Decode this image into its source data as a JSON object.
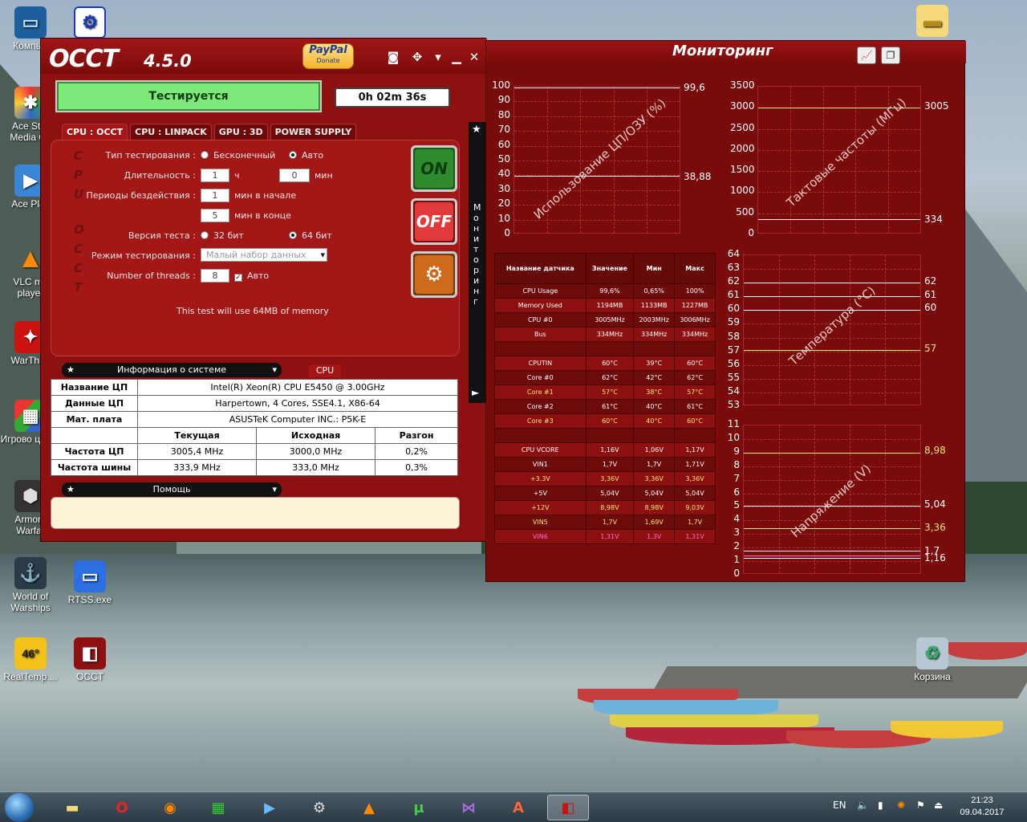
{
  "desktop": {
    "icons": [
      {
        "label": "Компью"
      },
      {
        "label": ""
      },
      {
        "label": "Ace Stre Media Ce"
      },
      {
        "label": "Ace Play"
      },
      {
        "label": "VLC me player"
      },
      {
        "label": "WarThun"
      },
      {
        "label": "Игрово центр"
      },
      {
        "label": "Armore Warfar"
      },
      {
        "label": "World of Warships"
      },
      {
        "label": "RTSS.exe"
      },
      {
        "label": "RealTemp...."
      },
      {
        "label": "OCCT"
      },
      {
        "label": "Корзина"
      }
    ]
  },
  "occt": {
    "logo": "OCCT",
    "version": "4.5.0",
    "paypal": {
      "brand": "PayPal",
      "action": "Donate"
    },
    "status": "Тестируется",
    "timer": "0h 02m 36s",
    "tabs": [
      "CPU : OCCT",
      "CPU : LINPACK",
      "GPU : 3D",
      "POWER SUPPLY"
    ],
    "side_letters_top": [
      "C",
      "P",
      "U"
    ],
    "side_letters_bottom": [
      "O",
      "C",
      "C",
      "T"
    ],
    "form": {
      "test_type_label": "Тип тестирования :",
      "test_type_opt1": "Бесконечный",
      "test_type_opt2": "Авто",
      "duration_label": "Длительность :",
      "duration_hours": "1",
      "hours_unit": "ч",
      "duration_minutes": "0",
      "minutes_unit": "мин",
      "idle_label": "Периоды бездействия :",
      "idle_start": "1",
      "idle_start_unit": "мин в начале",
      "idle_end": "5",
      "idle_end_unit": "мин в конце",
      "version_label": "Версия теста :",
      "version_opt1": "32 бит",
      "version_opt2": "64 бит",
      "mode_label": "Режим тестирования :",
      "mode_value": "Малый набор данных",
      "threads_label": "Number of threads :",
      "threads_value": "8",
      "threads_auto": "Авто",
      "memory_note": "This test will use 64MB of memory"
    },
    "buttons": {
      "on": "ON",
      "off": "OFF"
    },
    "monitor_vertical": "Мониторинг",
    "sysinfo": {
      "header": "Информация о системе",
      "cpu_tab": "CPU",
      "rows": [
        {
          "k": "Название ЦП",
          "v": "Intel(R) Xeon(R) CPU E5450 @ 3.00GHz"
        },
        {
          "k": "Данные ЦП",
          "v": "Harpertown, 4 Cores, SSE4.1, X86-64"
        },
        {
          "k": "Мат. плата",
          "v": "ASUSTeK Computer INC.: P5K-E"
        }
      ],
      "freq_headers": [
        "Текущая",
        "Исходная",
        "Разгон"
      ],
      "freq_rows": [
        {
          "k": "Частота ЦП",
          "cur": "3005,4 MHz",
          "base": "3000,0 MHz",
          "oc": "0,2%"
        },
        {
          "k": "Частота шины",
          "cur": "333,9 MHz",
          "base": "333,0 MHz",
          "oc": "0,3%"
        }
      ]
    },
    "help": {
      "header": "Помощь"
    }
  },
  "monitor": {
    "title": "Мониторинг",
    "charts": {
      "cpu_mem": {
        "title": "Использование ЦП/ОЗУ (%)",
        "ticks": [
          "100",
          "90",
          "80",
          "70",
          "60",
          "50",
          "40",
          "30",
          "20",
          "10",
          "0"
        ],
        "end_labels": [
          "99,6",
          "38,88"
        ]
      },
      "freq": {
        "title": "Тактовые частоты (МГц)",
        "ticks": [
          "3500",
          "3000",
          "2500",
          "2000",
          "1500",
          "1000",
          "500",
          "0"
        ],
        "end_labels": [
          "3005",
          "334"
        ]
      },
      "temp": {
        "title": "Температура (°С)",
        "ticks": [
          "64",
          "63",
          "62",
          "61",
          "60",
          "59",
          "58",
          "57",
          "56",
          "55",
          "54",
          "53"
        ],
        "end_labels": [
          "62",
          "61",
          "60",
          "57"
        ]
      },
      "volt": {
        "title": "Напряжение (V)",
        "ticks": [
          "11",
          "10",
          "9",
          "8",
          "7",
          "6",
          "5",
          "4",
          "3",
          "2",
          "1",
          "0"
        ],
        "end_labels": [
          "8,98",
          "5,04",
          "3,36",
          "1,7",
          "1,16"
        ]
      }
    },
    "sensors": {
      "headers": [
        "Название датчика",
        "Значение",
        "Мин",
        "Макс"
      ],
      "rows": [
        {
          "n": "CPU Usage",
          "v": "99,6%",
          "min": "0,65%",
          "max": "100%",
          "c": "#ffffff"
        },
        {
          "n": "Memory Used",
          "v": "1194MB",
          "min": "1133MB",
          "max": "1227MB",
          "c": "#ffffff"
        },
        {
          "n": "CPU #0",
          "v": "3005MHz",
          "min": "2003MHz",
          "max": "3006MHz",
          "c": "#ffffff"
        },
        {
          "n": "Bus",
          "v": "334MHz",
          "min": "334MHz",
          "max": "334MHz",
          "c": "#ffffff"
        },
        {
          "n": "",
          "v": "",
          "min": "",
          "max": "",
          "c": "#ffffff"
        },
        {
          "n": "CPUTIN",
          "v": "60°C",
          "min": "39°C",
          "max": "60°C",
          "c": "#ffffff"
        },
        {
          "n": "Core #0",
          "v": "62°C",
          "min": "42°C",
          "max": "62°C",
          "c": "#ffffff"
        },
        {
          "n": "Core #1",
          "v": "57°C",
          "min": "38°C",
          "max": "57°C",
          "c": "#f4e86a"
        },
        {
          "n": "Core #2",
          "v": "61°C",
          "min": "40°C",
          "max": "61°C",
          "c": "#ffffff"
        },
        {
          "n": "Core #3",
          "v": "60°C",
          "min": "40°C",
          "max": "60°C",
          "c": "#f4e86a"
        },
        {
          "n": "",
          "v": "",
          "min": "",
          "max": "",
          "c": "#ffffff"
        },
        {
          "n": "CPU VCORE",
          "v": "1,16V",
          "min": "1,06V",
          "max": "1,17V",
          "c": "#ffffff"
        },
        {
          "n": "VIN1",
          "v": "1,7V",
          "min": "1,7V",
          "max": "1,71V",
          "c": "#ffffff"
        },
        {
          "n": "+3.3V",
          "v": "3,36V",
          "min": "3,36V",
          "max": "3,36V",
          "c": "#f4e86a"
        },
        {
          "n": "+5V",
          "v": "5,04V",
          "min": "5,04V",
          "max": "5,04V",
          "c": "#ffffff"
        },
        {
          "n": "+12V",
          "v": "8,98V",
          "min": "8,98V",
          "max": "9,03V",
          "c": "#f4e86a"
        },
        {
          "n": "VIN5",
          "v": "1,7V",
          "min": "1,69V",
          "max": "1,7V",
          "c": "#f4e86a"
        },
        {
          "n": "VIN6",
          "v": "1,31V",
          "min": "1,3V",
          "max": "1,31V",
          "c": "#ff6ad0"
        }
      ]
    }
  },
  "taskbar": {
    "lang": "EN",
    "time": "21:23",
    "date": "09.04.2017"
  },
  "colors": {
    "occt_red": "#8e1111",
    "active_green": "#7ee87a",
    "series_yellow": "#e8e87a"
  }
}
